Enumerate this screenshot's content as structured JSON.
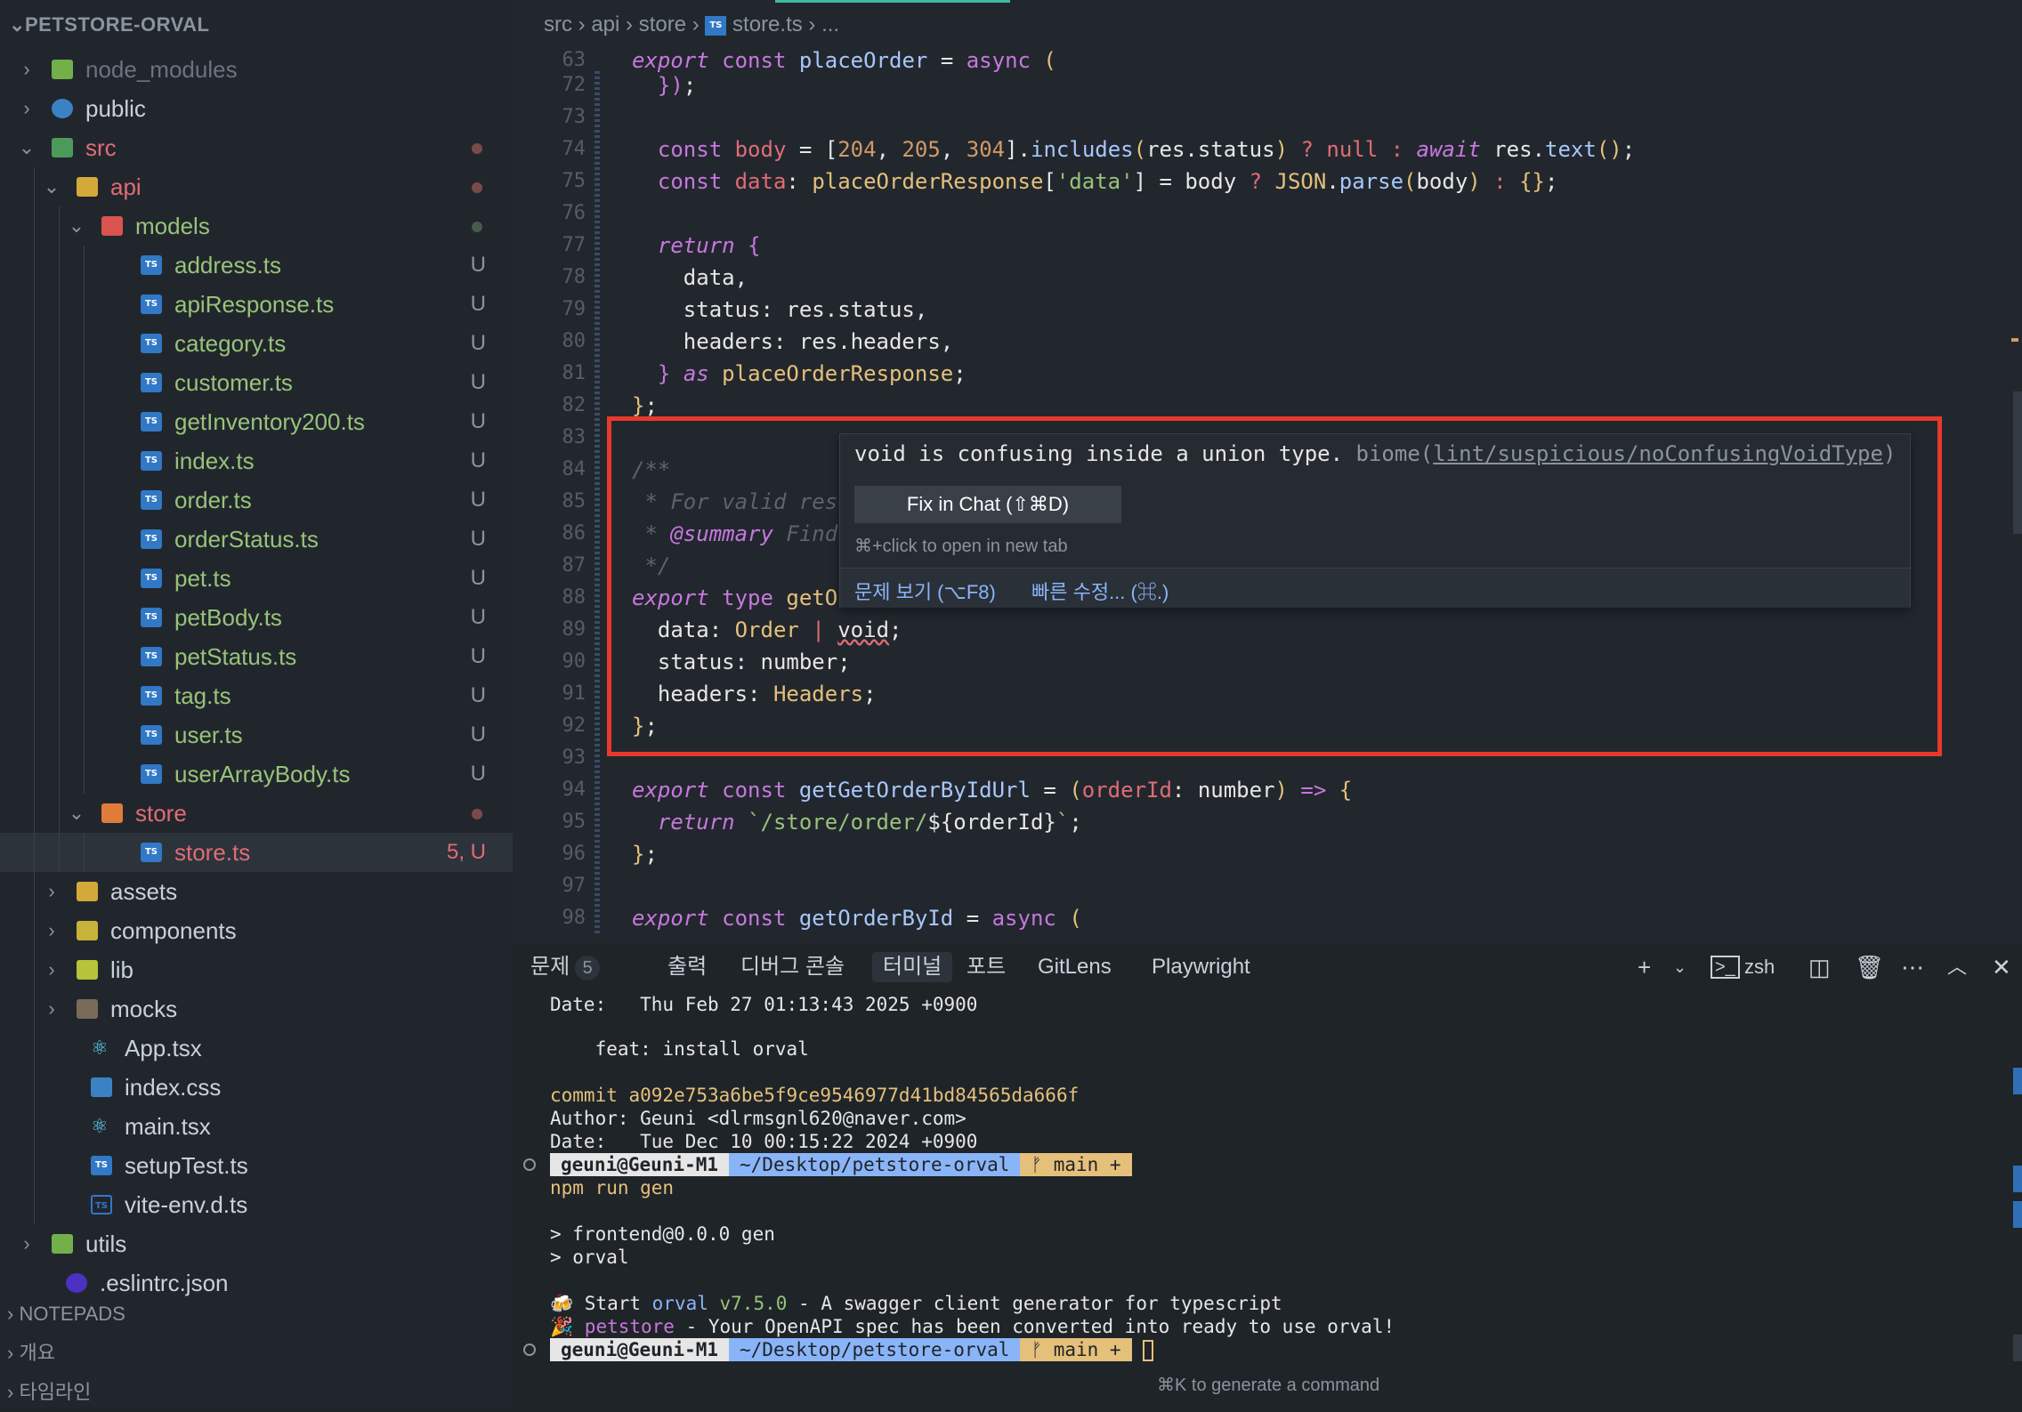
{
  "sidebar": {
    "title": "PETSTORE-ORVAL",
    "items": [
      {
        "label": "node_modules",
        "status": ""
      },
      {
        "label": "public",
        "status": ""
      },
      {
        "label": "src",
        "status": ""
      },
      {
        "label": "api",
        "status": ""
      },
      {
        "label": "models",
        "status": ""
      },
      {
        "label": "address.ts",
        "status": "U"
      },
      {
        "label": "apiResponse.ts",
        "status": "U"
      },
      {
        "label": "category.ts",
        "status": "U"
      },
      {
        "label": "customer.ts",
        "status": "U"
      },
      {
        "label": "getInventory200.ts",
        "status": "U"
      },
      {
        "label": "index.ts",
        "status": "U"
      },
      {
        "label": "order.ts",
        "status": "U"
      },
      {
        "label": "orderStatus.ts",
        "status": "U"
      },
      {
        "label": "pet.ts",
        "status": "U"
      },
      {
        "label": "petBody.ts",
        "status": "U"
      },
      {
        "label": "petStatus.ts",
        "status": "U"
      },
      {
        "label": "tag.ts",
        "status": "U"
      },
      {
        "label": "user.ts",
        "status": "U"
      },
      {
        "label": "userArrayBody.ts",
        "status": "U"
      },
      {
        "label": "store",
        "status": ""
      },
      {
        "label": "store.ts",
        "status": "5, U"
      },
      {
        "label": "assets",
        "status": ""
      },
      {
        "label": "components",
        "status": ""
      },
      {
        "label": "lib",
        "status": ""
      },
      {
        "label": "mocks",
        "status": ""
      },
      {
        "label": "App.tsx",
        "status": ""
      },
      {
        "label": "index.css",
        "status": ""
      },
      {
        "label": "main.tsx",
        "status": ""
      },
      {
        "label": "setupTest.ts",
        "status": ""
      },
      {
        "label": "vite-env.d.ts",
        "status": ""
      },
      {
        "label": "utils",
        "status": ""
      },
      {
        "label": ".eslintrc.json",
        "status": ""
      }
    ],
    "sections": [
      "NOTEPADS",
      "개요",
      "타임라인"
    ]
  },
  "breadcrumb": {
    "parts": [
      "src",
      "api",
      "store",
      "store.ts",
      "..."
    ]
  },
  "hover": {
    "message": "void is confusing inside a union type.",
    "source": "biome(",
    "rule": "lint/suspicious/noConfusingVoidType",
    "close": ")",
    "fix_button": "Fix in Chat (⇧⌘D)",
    "hint": "⌘+click to open in new tab",
    "view_problem": "문제 보기 (⌥F8)",
    "quick_fix": "빠른 수정... (⌘.)"
  },
  "panel": {
    "tabs": [
      "문제",
      "출력",
      "디버그 콘솔",
      "터미널",
      "포트",
      "GitLens",
      "Playwright"
    ],
    "problems_count": "5",
    "shell": "zsh",
    "terminal_hint": "⌘K to generate a command"
  },
  "terminal": {
    "date1": "Date:   Thu Feb 27 01:13:43 2025 +0900",
    "msg1": "    feat: install orval",
    "commit": "commit a092e753a6be5f9ce9546977d41bd84565da666f",
    "author": "Author: Geuni <dlrmsgnl620@naver.com>",
    "date2": "Date:   Tue Dec 10 00:15:22 2024 +0900",
    "user": "geuni@Geuni-M1",
    "path": "~/Desktop/petstore-orval",
    "branch": "ᚠ main +",
    "cmd": "npm run gen",
    "out1": "> frontend@0.0.0 gen",
    "out2": "> orval",
    "start_pre": "🍻 Start ",
    "start_orval": "orval",
    "start_ver": " v7.5.0",
    "start_post": " - A swagger client generator for typescript",
    "done_pre": "🎉 ",
    "done_name": "petstore",
    "done_post": " - Your OpenAPI spec has been converted into ready to use orval!"
  },
  "colors": {
    "accent": "#3fb9a0",
    "highlight_box": "#e8392a"
  }
}
